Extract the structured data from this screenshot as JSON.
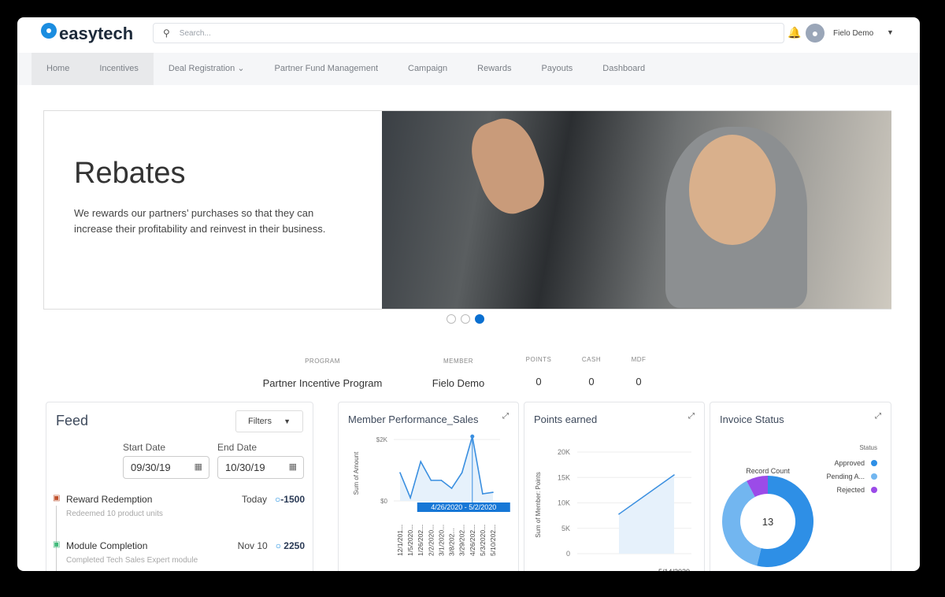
{
  "header": {
    "logo": "easytech",
    "search_placeholder": "Search...",
    "user_name": "Fielo Demo"
  },
  "nav": [
    "Home",
    "Incentives",
    "Deal Registration",
    "Partner Fund Management",
    "Campaign",
    "Rewards",
    "Payouts",
    "Dashboard"
  ],
  "hero": {
    "title": "Rebates",
    "text": "We rewards our partners’ purchases so that they can increase their profitability and reinvest in their business.",
    "slides": 3,
    "active_slide": 3
  },
  "stats": {
    "program_label": "PROGRAM",
    "program": "Partner Incentive Program",
    "member_label": "MEMBER",
    "member": "Fielo Demo",
    "points_label": "POINTS",
    "points": "0",
    "cash_label": "CASH",
    "cash": "0",
    "mdf_label": "MDF",
    "mdf": "0"
  },
  "feed": {
    "title": "Feed",
    "filters": "Filters",
    "start_label": "Start Date",
    "start": "09/30/19",
    "end_label": "End Date",
    "end": "10/30/19",
    "items": [
      {
        "name": "Reward Redemption",
        "date": "Today",
        "points": "-1500",
        "desc": "Redeemed 10 product units"
      },
      {
        "name": "Module Completion",
        "date": "Nov 10",
        "points": "2250",
        "desc": "Completed Tech Sales Expert module"
      }
    ]
  },
  "chart_data": [
    {
      "type": "line",
      "title": "Member Performance_Sales",
      "ylabel": "Sum of Amount",
      "yticks": [
        "$0",
        "$2K"
      ],
      "ylim": [
        0,
        2000
      ],
      "categories": [
        "12/1/201...",
        "1/5/2020...",
        "1/26/202...",
        "2/2/2020...",
        "3/1/2020...",
        "3/8/202...",
        "3/29/202...",
        "4/26/202...",
        "5/3/2020...",
        "5/10/202..."
      ],
      "values": [
        920,
        100,
        1280,
        670,
        670,
        410,
        920,
        2100,
        230,
        280
      ],
      "tooltip": "4/26/2020 - 5/2/2020",
      "highlight_index": 7
    },
    {
      "type": "area",
      "title": "Points earned",
      "ylabel": "Sum of Member: Points",
      "yticks": [
        "0",
        "5K",
        "10K",
        "15K",
        "20K"
      ],
      "ylim": [
        0,
        20000
      ],
      "categories": [
        "-",
        "5/14/2020"
      ],
      "values": [
        7800,
        15500
      ]
    },
    {
      "type": "pie",
      "title": "Invoice Status",
      "center_label": "Record Count",
      "total": "13",
      "legend_title": "Status",
      "slices": [
        {
          "name": "Approved",
          "value": 7,
          "color": "#2e8fe6"
        },
        {
          "name": "Pending A...",
          "value": 5,
          "color": "#72b6f0"
        },
        {
          "name": "Rejected",
          "value": 1,
          "color": "#9b4be8"
        }
      ]
    }
  ]
}
